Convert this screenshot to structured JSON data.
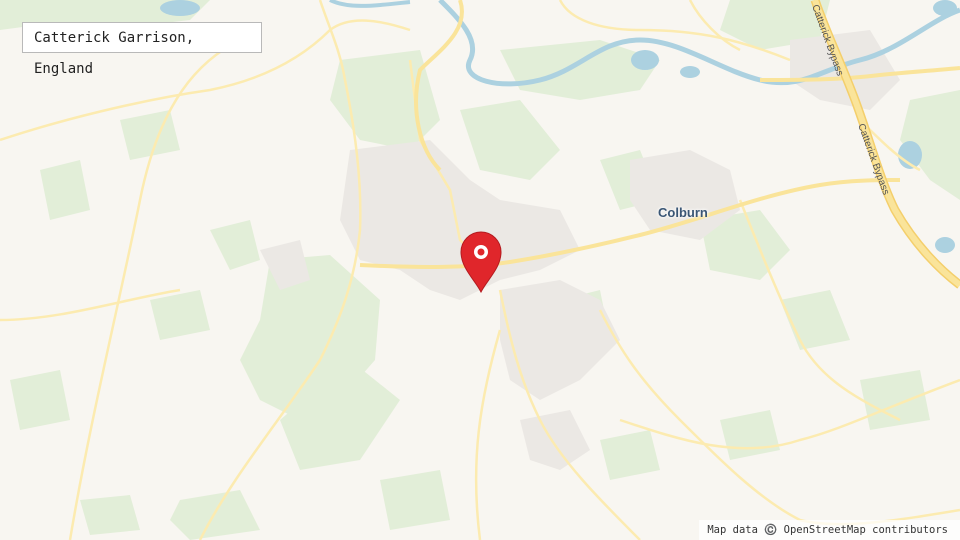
{
  "search": {
    "value": "Catterick Garrison, England"
  },
  "labels": {
    "colburn": "Colburn",
    "bypass_top": "Catterick Bypass",
    "bypass_bottom": "Catterick Bypass"
  },
  "attribution": "Map data ©️ OpenStreetMap contributors",
  "marker": {
    "icon": "map-pin-icon",
    "color": "#e0262b"
  },
  "colors": {
    "land": "#f8f6f1",
    "green": "#e2eed8",
    "water": "#acd1e0",
    "road": "#fcebb0",
    "major_road": "#f6d477",
    "urban": "#ece9e6"
  }
}
